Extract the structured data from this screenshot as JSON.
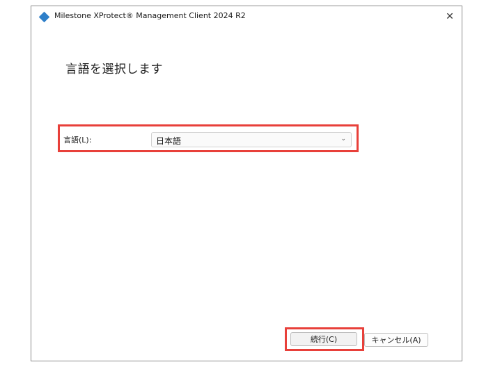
{
  "window": {
    "title": "Milestone XProtect® Management Client 2024 R2",
    "close_glyph": "✕"
  },
  "page": {
    "heading": "言語を選択します"
  },
  "language": {
    "label": "言語(L):",
    "selected": "日本語",
    "dropdown_icon": "chevron-down-icon"
  },
  "buttons": {
    "continue_label": "続行(C)",
    "cancel_label": "キャンセル(A)"
  },
  "colors": {
    "highlight": "#e8403a",
    "app_icon": "#2e7fc9"
  }
}
